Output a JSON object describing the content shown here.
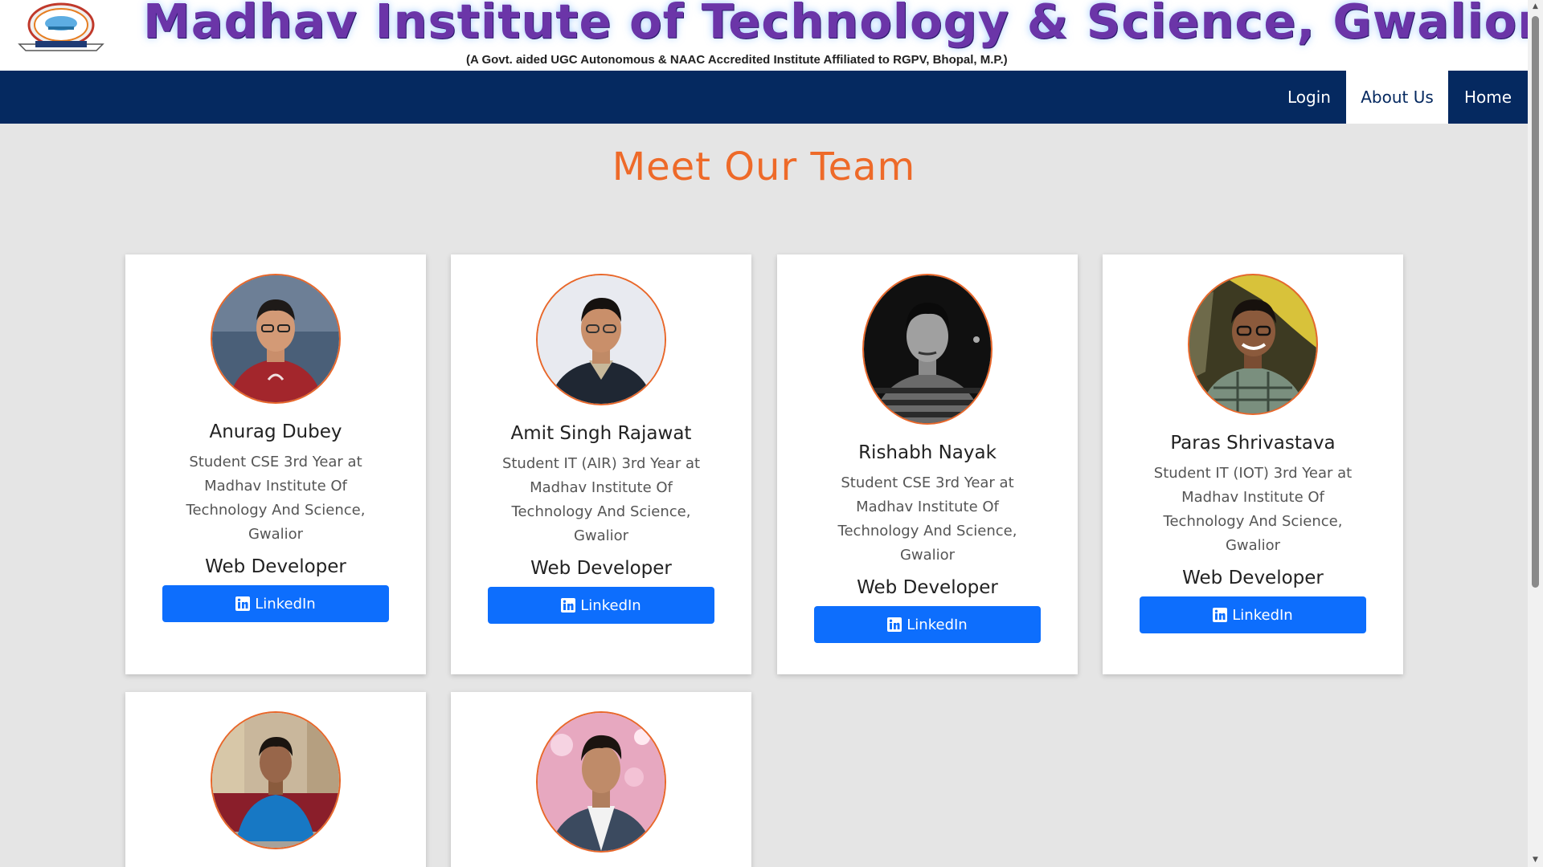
{
  "banner": {
    "title": "Madhav Institute of Technology & Science, Gwalior",
    "subtitle": "(A Govt. aided UGC Autonomous  & NAAC Accredited Institute Affiliated to RGPV, Bhopal, M.P.)",
    "logo_icon": "institute-seal-icon"
  },
  "nav": {
    "login": "Login",
    "about": "About Us",
    "home": "Home",
    "active": "About Us"
  },
  "section": {
    "title": "Meet Our Team"
  },
  "team": [
    {
      "name": "Anurag Dubey",
      "desc": "Student CSE 3rd Year at Madhav Institute Of Technology And Science, Gwalior",
      "role": "Web Developer",
      "button": "LinkedIn"
    },
    {
      "name": "Amit Singh Rajawat",
      "desc": "Student IT (AIR) 3rd Year at Madhav Institute Of Technology And Science, Gwalior",
      "role": "Web Developer",
      "button": "LinkedIn"
    },
    {
      "name": "Rishabh Nayak",
      "desc": "Student CSE 3rd Year at Madhav Institute Of Technology And Science, Gwalior",
      "role": "Web Developer",
      "button": "LinkedIn"
    },
    {
      "name": "Paras Shrivastava",
      "desc": "Student IT (IOT) 3rd Year at Madhav Institute Of Technology And Science, Gwalior",
      "role": "Web Developer",
      "button": "LinkedIn"
    },
    {
      "name": "",
      "desc": "",
      "role": "",
      "button": ""
    },
    {
      "name": "",
      "desc": "",
      "role": "",
      "button": ""
    }
  ],
  "colors": {
    "navbar": "#052960",
    "accent": "#ee6a29",
    "button": "#0d6efd",
    "background": "#e5e5e5"
  }
}
